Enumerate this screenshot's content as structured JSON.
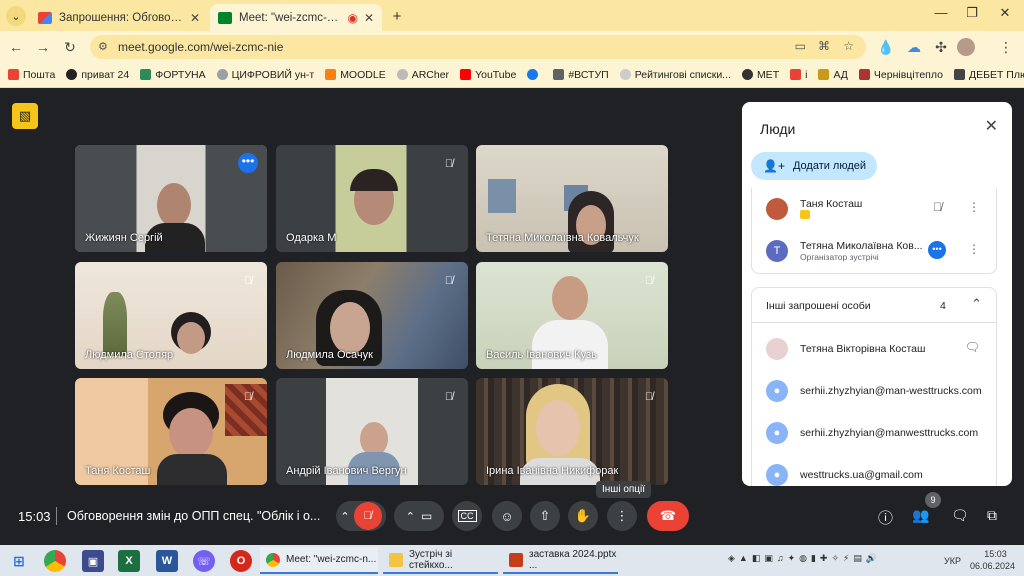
{
  "browser": {
    "tabs": [
      {
        "title": "Запрошення: Обговорення змін до ОПП спец.",
        "active": false
      },
      {
        "title": "Meet: \"wei-zcmc-nie\"",
        "active": true
      }
    ],
    "new_tab": "+",
    "url": "meet.google.com/wei-zcmc-nie",
    "bookmarks": [
      "Пошта",
      "приват 24",
      "ФОРТУНА",
      "ЦИФРОВИЙ ун-т",
      "MOODLE",
      "ARCher",
      "YouTube",
      "#ВСТУП",
      "Рейтингові списки...",
      "MET",
      "i",
      "АД",
      "Чернівцітепло",
      "ДЕБЕТ Плюс"
    ]
  },
  "meet": {
    "tiles": [
      {
        "name": "Жижиян Сергій",
        "muted": false,
        "speaking": true,
        "more": "•••"
      },
      {
        "name": "Одарка М",
        "muted": true
      },
      {
        "name": "Тетяна Миколаївна Ковальчук",
        "muted": false
      },
      {
        "name": "Людмила Столяр",
        "muted": true
      },
      {
        "name": "Людмила Осачук",
        "muted": true
      },
      {
        "name": "Василь Іванович Кузь",
        "muted": true
      },
      {
        "name": "Таня Косташ",
        "muted": true
      },
      {
        "name": "Андрій Іванович Вергун",
        "muted": true
      },
      {
        "name": "Ірина Іванівна Никифорак",
        "muted": true
      }
    ],
    "time": "15:03",
    "meeting_title": "Обговорення змін до ОПП спец. \"Облік і о...",
    "tooltip": "Інші опції",
    "people_count": "9"
  },
  "people_panel": {
    "title": "Люди",
    "add_people": "Додати людей",
    "participants": [
      {
        "name": "Таня Косташ",
        "sub": ""
      },
      {
        "name": "Тетяна Миколаївна Ков...",
        "sub": "Організатор зустрічі",
        "initial": "Т"
      }
    ],
    "invited_header": "Інші запрошені особи",
    "invited_count": "4",
    "invited": [
      "Тетяна Вікторівна Косташ",
      "serhii.zhyzhyian@man-westtrucks.com",
      "serhii.zhyzhyian@manwesttrucks.com",
      "westtrucks.ua@gmail.com"
    ]
  },
  "taskbar": {
    "tasks": [
      "Meet: \"wei-zcmc-n...",
      "Зустріч зі стейкхо...",
      "заставка 2024.pptx ..."
    ],
    "lang": "УКР",
    "time": "15:03",
    "date": "06.06.2024"
  },
  "colors": {
    "accent": "#1a73e8",
    "hangup": "#ea4335",
    "tabbar": "#fbe7a1"
  }
}
